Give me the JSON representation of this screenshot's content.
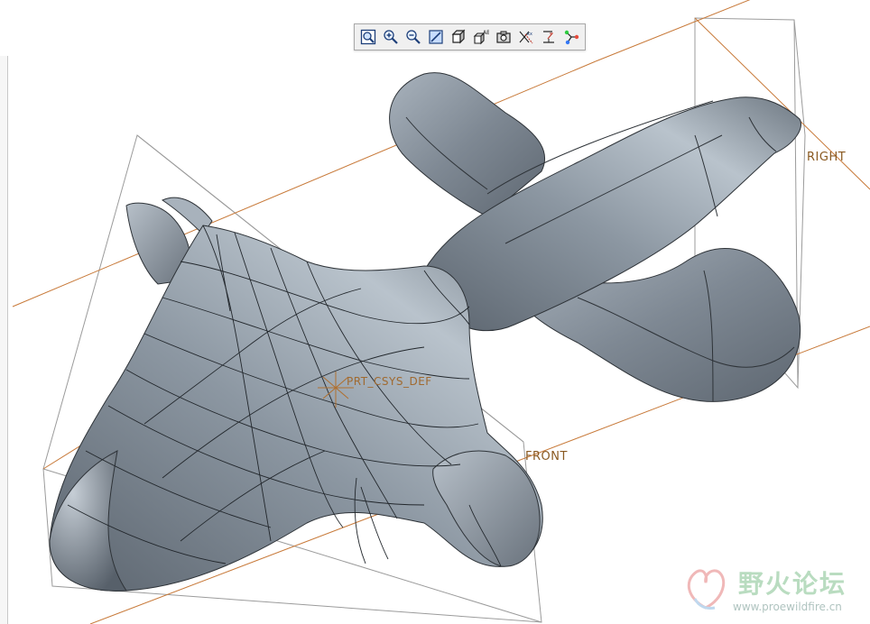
{
  "toolbar": {
    "buttons": [
      {
        "name": "refit-zoom-button",
        "icon": "refit-icon"
      },
      {
        "name": "zoom-in-button",
        "icon": "zoom-in-icon"
      },
      {
        "name": "zoom-out-button",
        "icon": "zoom-out-icon"
      },
      {
        "name": "repaint-button",
        "icon": "repaint-icon"
      },
      {
        "name": "display-style-button",
        "icon": "shaded-cube-icon"
      },
      {
        "name": "saved-views-button",
        "icon": "saved-views-icon"
      },
      {
        "name": "view-manager-button",
        "icon": "camera-icon"
      },
      {
        "name": "datum-display-button",
        "icon": "datum-planes-icon"
      },
      {
        "name": "annotation-display-button",
        "icon": "annotation-icon"
      },
      {
        "name": "spin-center-button",
        "icon": "spin-center-icon"
      }
    ]
  },
  "datums": {
    "right_plane": "RIGHT",
    "front_plane": "FRONT",
    "csys": "PRT_CSYS_DEF"
  },
  "watermark": {
    "title": "野火论坛",
    "url": "www.proewildfire.cn"
  },
  "colors": {
    "model_dark": "#5d6670",
    "model_mid": "#8d97a2",
    "model_light": "#c9d1d9",
    "datum_plane": "#9a9a9a",
    "datum_edge": "#c87a3a",
    "datum_label": "#8a5a22",
    "toolbar_bg": "#f0f0f0"
  }
}
